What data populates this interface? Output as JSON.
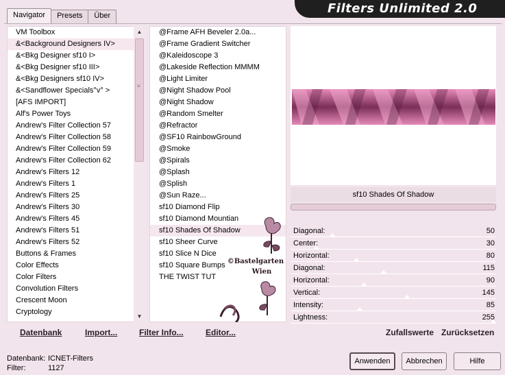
{
  "title": "Filters Unlimited 2.0",
  "tabs": [
    {
      "label": "Navigator",
      "active": true
    },
    {
      "label": "Presets",
      "active": false
    },
    {
      "label": "Über",
      "active": false
    }
  ],
  "categories": [
    "VM Toolbox",
    "&<Background Designers IV>",
    "&<Bkg Designer sf10 I>",
    "&<Bkg Designer sf10 III>",
    "&<Bkg Designers sf10 IV>",
    "&<Sandflower Specials°v° >",
    "[AFS IMPORT]",
    "Alf's Power Toys",
    "Andrew's Filter Collection 57",
    "Andrew's Filter Collection 58",
    "Andrew's Filter Collection 59",
    "Andrew's Filter Collection 62",
    "Andrew's Filters 12",
    "Andrew's Filters 1",
    "Andrew's Filters 25",
    "Andrew's Filters 30",
    "Andrew's Filters 45",
    "Andrew's Filters 51",
    "Andrew's Filters 52",
    "Buttons & Frames",
    "Color Effects",
    "Color Filters",
    "Convolution Filters",
    "Crescent Moon",
    "Cryptology"
  ],
  "selected_category": "&<Background Designers IV>",
  "filters": [
    "@Frame AFH Beveler 2.0a...",
    "@Frame Gradient Switcher",
    "@Kaleidoscope 3",
    "@Lakeside Reflection MMMM",
    "@Light Limiter",
    "@Night Shadow Pool",
    "@Night Shadow",
    "@Random Smelter",
    "@Refractor",
    "@SF10 RainbowGround",
    "@Smoke",
    "@Spirals",
    "@Splash",
    "@Splish",
    "@Sun Raze...",
    "sf10 Diamond Flip",
    "sf10 Diamond Mountian",
    "sf10 Shades Of Shadow",
    "sf10 Sheer Curve",
    "sf10 Slice N Dice",
    "sf10 Square Bumps",
    "THE TWIST TUT"
  ],
  "selected_filter": "sf10 Shades Of Shadow",
  "watermark": {
    "line1": "©Bastelgarten",
    "line2": "Wien"
  },
  "preview": {
    "filter_name": "sf10 Shades Of Shadow",
    "band_color_light": "#e58ab8",
    "band_color_dark": "#7a2e58"
  },
  "parameters": [
    {
      "label": "Diagonal:",
      "value": "50",
      "level": 50
    },
    {
      "label": "Center:",
      "value": "30",
      "level": 30
    },
    {
      "label": "Horizontal:",
      "value": "80",
      "level": 80
    },
    {
      "label": "Diagonal:",
      "value": "115",
      "level": 115
    },
    {
      "label": "Horizontal:",
      "value": "90",
      "level": 90
    },
    {
      "label": "Vertical:",
      "value": "145",
      "level": 145
    },
    {
      "label": "Intensity:",
      "value": "85",
      "level": 85
    },
    {
      "label": "Lightness:",
      "value": "255",
      "level": 255
    }
  ],
  "bottom_buttons": {
    "database": "Datenbank",
    "import": "Import...",
    "filter_info": "Filter Info...",
    "editor": "Editor...",
    "random": "Zufallswerte",
    "reset": "Zurücksetzen"
  },
  "status": {
    "db_label": "Datenbank:",
    "db_value": "ICNET-Filters",
    "filter_label": "Filter:",
    "filter_value": "1127"
  },
  "dialog_buttons": {
    "apply": "Anwenden",
    "cancel": "Abbrechen",
    "help": "Hilfe"
  },
  "colors": {
    "background": "#f2e4ec",
    "title_bar": "#1f1f1f",
    "accent": "#e58ab8"
  }
}
